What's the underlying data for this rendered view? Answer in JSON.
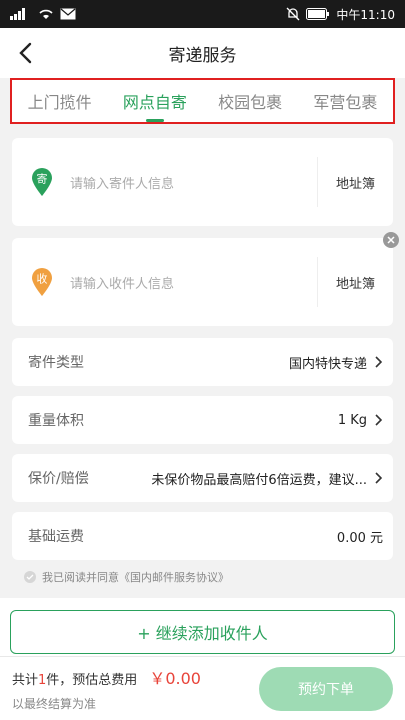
{
  "status_bar": {
    "time": "中午11:10"
  },
  "navbar": {
    "title": "寄递服务"
  },
  "tabs": [
    {
      "label": "上门揽件",
      "active": false
    },
    {
      "label": "网点自寄",
      "active": true
    },
    {
      "label": "校园包裹",
      "active": false
    },
    {
      "label": "军营包裹",
      "active": false
    }
  ],
  "sender": {
    "badge": "寄",
    "placeholder": "请输入寄件人信息",
    "book": "地址簿"
  },
  "receiver": {
    "badge": "收",
    "placeholder": "请输入收件人信息",
    "book": "地址簿"
  },
  "rows": {
    "type": {
      "label": "寄件类型",
      "value": "国内特快专递"
    },
    "weight": {
      "label": "重量体积",
      "value": "1 Kg"
    },
    "insure": {
      "label": "保价/赔偿",
      "value": "未保价物品最高赔付6倍运费，建议..."
    },
    "fee": {
      "label": "基础运费",
      "value": "0.00 元"
    }
  },
  "agreement": {
    "prefix": "我已阅读并同意",
    "link": "《国内邮件服务协议》"
  },
  "add_receiver": {
    "label": "+ 继续添加收件人"
  },
  "footer": {
    "count_prefix": "共计",
    "count": "1",
    "count_suffix": "件，预估总费用",
    "amount": "￥0.00",
    "note": "以最终结算为准",
    "order_button": "预约下单"
  },
  "colors": {
    "accent_green": "#2aa15c",
    "sender_badge": "#2aa15c",
    "receiver_badge": "#f0a040",
    "price_red": "#e8443a",
    "highlight_border": "#e02020"
  }
}
